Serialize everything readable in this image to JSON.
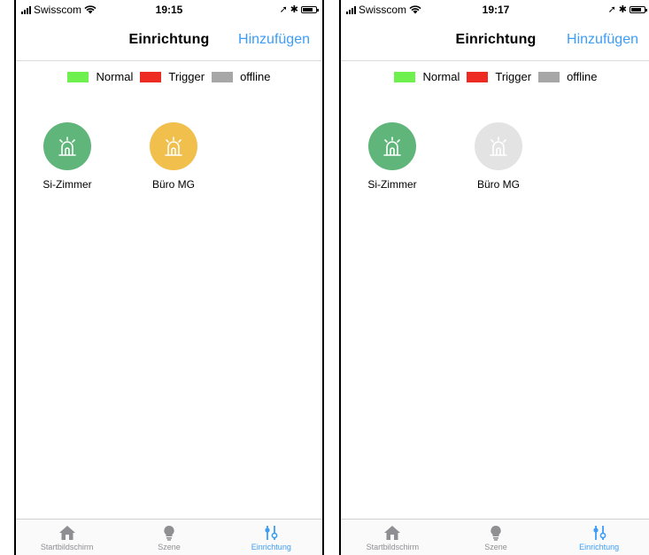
{
  "legend": [
    {
      "label": "Normal",
      "color": "#6ef04f"
    },
    {
      "label": "Trigger",
      "color": "#ee2b22"
    },
    {
      "label": "offline",
      "color": "#a7a7a7"
    }
  ],
  "tabs": [
    {
      "label": "Startbildschirm",
      "icon": "home-icon"
    },
    {
      "label": "Szene",
      "icon": "lightbulb-icon"
    },
    {
      "label": "Einrichtung",
      "icon": "sliders-icon",
      "active": true
    }
  ],
  "screens": [
    {
      "status": {
        "carrier": "Swisscom",
        "time": "19:15"
      },
      "header": {
        "title": "Einrichtung",
        "action": "Hinzufügen"
      },
      "devices": [
        {
          "label": "Si-Zimmer",
          "state": "Normal",
          "color": "#5fb57a",
          "icon": "alarm-light-icon"
        },
        {
          "label": "Büro MG",
          "state": "Trigger",
          "color": "#f1bf4c",
          "icon": "alarm-light-icon"
        }
      ]
    },
    {
      "status": {
        "carrier": "Swisscom",
        "time": "19:17"
      },
      "header": {
        "title": "Einrichtung",
        "action": "Hinzufügen"
      },
      "devices": [
        {
          "label": "Si-Zimmer",
          "state": "Normal",
          "color": "#5fb57a",
          "icon": "alarm-light-icon"
        },
        {
          "label": "Büro MG",
          "state": "offline",
          "color": "#e3e3e3",
          "icon": "alarm-light-icon"
        }
      ]
    }
  ]
}
